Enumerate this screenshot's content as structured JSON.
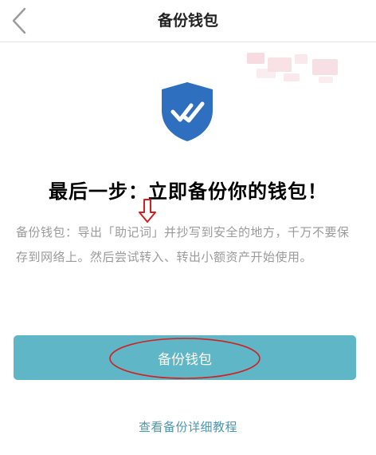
{
  "nav": {
    "back_icon": "chevron-left-icon",
    "title": "备份钱包"
  },
  "hero": {
    "icon": "shield-check-icon",
    "shield_color": "#2f6fbf",
    "headline": "最后一步：立即备份你的钱包！"
  },
  "description": "备份钱包：导出「助记词」并抄写到安全的地方，千万不要保存到网络上。然后尝试转入、转出小额资产开始使用。",
  "actions": {
    "backup_button_label": "备份钱包",
    "button_color": "#5fb6c6",
    "tutorial_link_label": "查看备份详细教程",
    "link_color": "#4d96ae"
  },
  "annotations": {
    "color": "#d21f1f"
  }
}
